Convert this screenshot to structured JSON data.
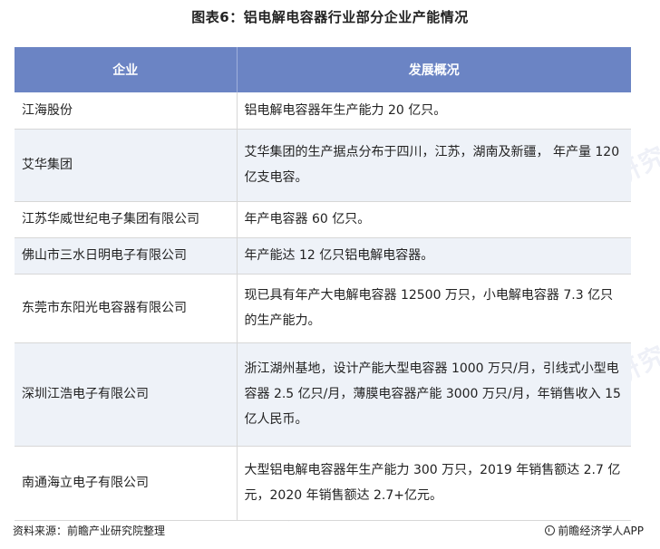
{
  "title": "图表6：铝电解电容器行业部分企业产能情况",
  "table": {
    "headers": [
      "企业",
      "发展概况"
    ],
    "rows": [
      {
        "company": "江海股份",
        "desc": "铝电解电容器年生产能力 20 亿只。"
      },
      {
        "company": "艾华集团",
        "desc": "艾华集团的生产据点分布于四川，江苏，湖南及新疆， 年产量 120 亿支电容。"
      },
      {
        "company": "江苏华威世纪电子集团有限公司",
        "desc": "年产电容器 60 亿只。"
      },
      {
        "company": "佛山市三水日明电子有限公司",
        "desc": "年产能达 12 亿只铝电解电容器。"
      },
      {
        "company": "东莞市东阳光电容器有限公司",
        "desc": "现已具有年产大电解电容器 12500 万只，小电解电容器 7.3 亿只的生产能力。"
      },
      {
        "company": "深圳江浩电子有限公司",
        "desc": "浙江湖州基地，设计产能大型电容器 1000 万只/月，引线式小型电容器 2.5 亿只/月，薄膜电容器产能 3000 万只/月，年销售收入 15 亿人民币。"
      },
      {
        "company": "南通海立电子有限公司",
        "desc": "大型铝电解电容器年生产能力 300 万只，2019 年销售额达 2.7 亿元，2020 年销售额达 2.7+亿元。"
      }
    ]
  },
  "footer": {
    "source": "资料来源：前瞻产业研究院整理",
    "brand": "前瞻经济学人APP"
  },
  "watermark": "前瞻产业研究院"
}
